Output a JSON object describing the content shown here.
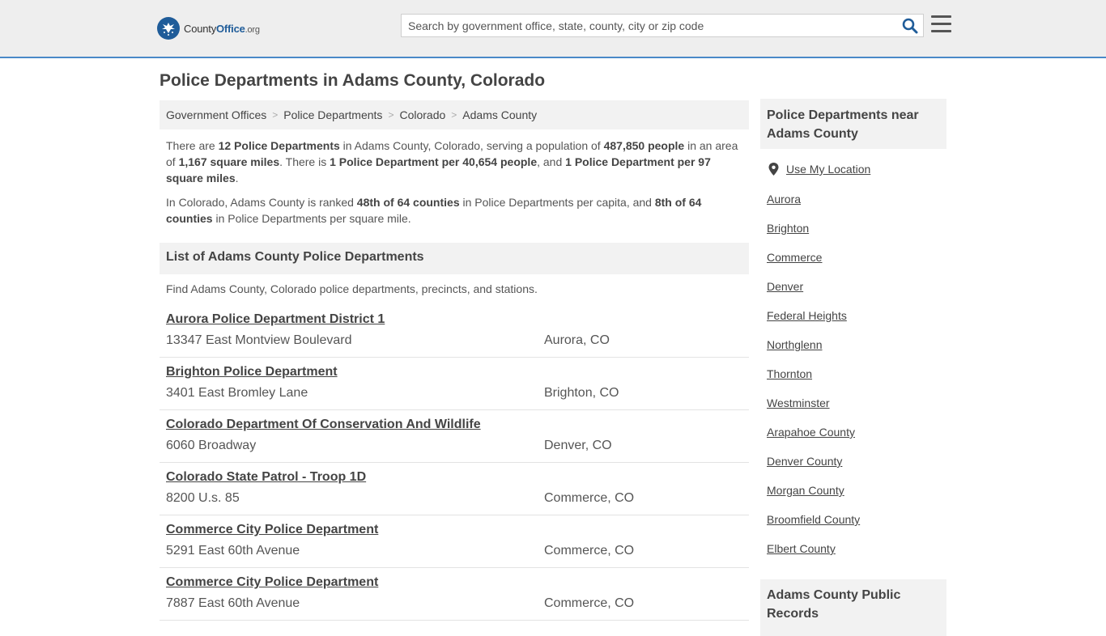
{
  "header": {
    "logo_part1": "County",
    "logo_part2": "Office",
    "logo_part3": ".org",
    "search_placeholder": "Search by government office, state, county, city or zip code"
  },
  "page_title": "Police Departments in Adams County, Colorado",
  "breadcrumb": [
    "Government Offices",
    "Police Departments",
    "Colorado",
    "Adams County"
  ],
  "intro": {
    "p1": [
      {
        "t": "There are ",
        "b": false
      },
      {
        "t": "12 Police Departments",
        "b": true
      },
      {
        "t": " in Adams County, Colorado, serving a population of ",
        "b": false
      },
      {
        "t": "487,850 people",
        "b": true
      },
      {
        "t": " in an area of ",
        "b": false
      },
      {
        "t": "1,167 square miles",
        "b": true
      },
      {
        "t": ". There is ",
        "b": false
      },
      {
        "t": "1 Police Department per 40,654 people",
        "b": true
      },
      {
        "t": ", and ",
        "b": false
      },
      {
        "t": "1 Police Department per 97 square miles",
        "b": true
      },
      {
        "t": ".",
        "b": false
      }
    ],
    "p2": [
      {
        "t": "In Colorado, Adams County is ranked ",
        "b": false
      },
      {
        "t": "48th of 64 counties",
        "b": true
      },
      {
        "t": " in Police Departments per capita, and ",
        "b": false
      },
      {
        "t": "8th of 64 counties",
        "b": true
      },
      {
        "t": " in Police Departments per square mile.",
        "b": false
      }
    ]
  },
  "list_section": {
    "title": "List of Adams County Police Departments",
    "description": "Find Adams County, Colorado police departments, precincts, and stations."
  },
  "departments": [
    {
      "name": "Aurora Police Department District 1",
      "address": "13347 East Montview Boulevard",
      "city": "Aurora, CO"
    },
    {
      "name": "Brighton Police Department",
      "address": "3401 East Bromley Lane",
      "city": "Brighton, CO"
    },
    {
      "name": "Colorado Department Of Conservation And Wildlife",
      "address": "6060 Broadway",
      "city": "Denver, CO"
    },
    {
      "name": "Colorado State Patrol - Troop 1D",
      "address": "8200 U.s. 85",
      "city": "Commerce, CO"
    },
    {
      "name": "Commerce City Police Department",
      "address": "5291 East 60th Avenue",
      "city": "Commerce, CO"
    },
    {
      "name": "Commerce City Police Department",
      "address": "7887 East 60th Avenue",
      "city": "Commerce, CO"
    }
  ],
  "sidebar": {
    "nearby_title": "Police Departments near Adams County",
    "use_location": "Use My Location",
    "links": [
      "Aurora",
      "Brighton",
      "Commerce",
      "Denver",
      "Federal Heights",
      "Northglenn",
      "Thornton",
      "Westminster",
      "Arapahoe County",
      "Denver County",
      "Morgan County",
      "Broomfield County",
      "Elbert County"
    ],
    "records_title": "Adams County Public Records"
  }
}
